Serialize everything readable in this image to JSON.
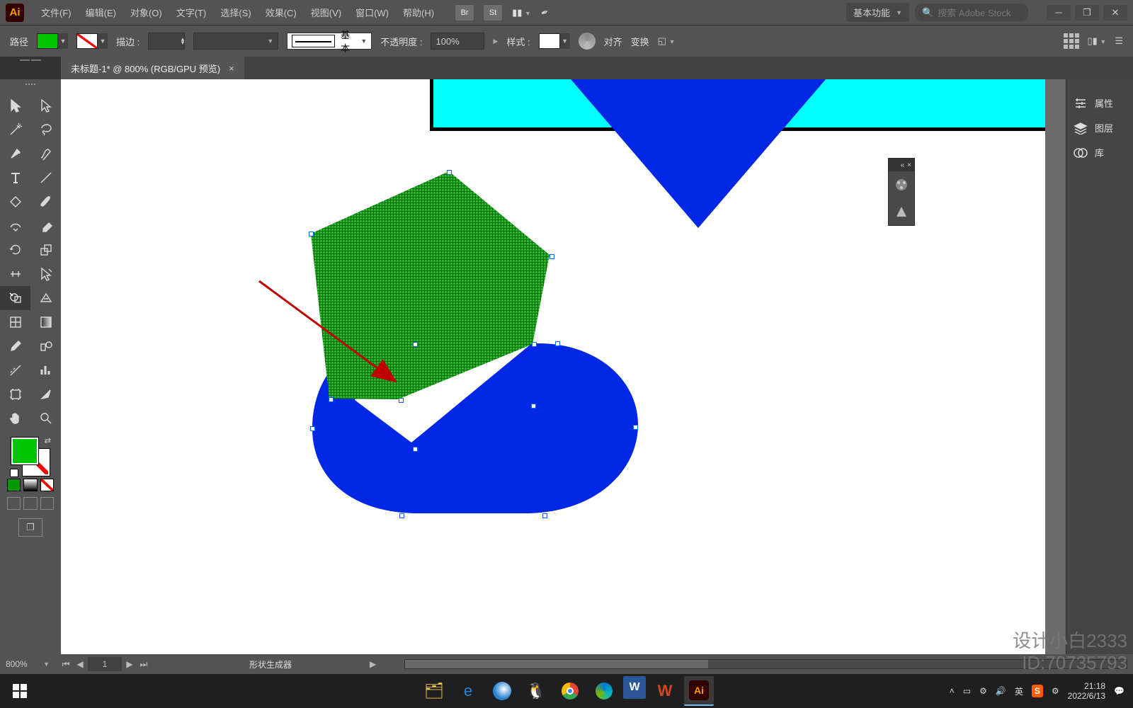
{
  "menu": {
    "file": "文件(F)",
    "edit": "编辑(E)",
    "object": "对象(O)",
    "type": "文字(T)",
    "select": "选择(S)",
    "effect": "效果(C)",
    "view": "视图(V)",
    "window": "窗口(W)",
    "help": "帮助(H)"
  },
  "workspace_label": "基本功能",
  "search_placeholder": "搜索 Adobe Stock",
  "options": {
    "mode": "路径",
    "stroke_label": "描边 :",
    "stroke_val": "",
    "profile_label": "基本",
    "opacity_label": "不透明度 :",
    "opacity_val": "100%",
    "style_label": "样式 :",
    "align_label": "对齐",
    "transform_label": "变换"
  },
  "doc_tab": "未标题-1* @ 800% (RGB/GPU 预览)",
  "status": {
    "zoom": "800%",
    "artboard": "1",
    "tool": "形状生成器"
  },
  "right_panel": {
    "properties": "属性",
    "layers": "图层",
    "libraries": "库"
  },
  "watermark": {
    "line1": "设计小白2333",
    "line2": "ID:70735793"
  },
  "tray": {
    "ime": "英",
    "time": "21:18",
    "date": "2022/6/13"
  },
  "colors": {
    "fill": "#00c400",
    "cyan": "#00ffff",
    "blue": "#0026e6",
    "green": "#2ab82a"
  }
}
